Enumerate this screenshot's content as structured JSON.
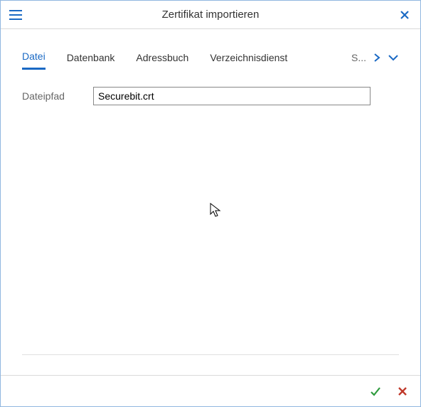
{
  "header": {
    "title": "Zertifikat importieren"
  },
  "tabs": {
    "items": [
      {
        "label": "Datei",
        "active": true
      },
      {
        "label": "Datenbank",
        "active": false
      },
      {
        "label": "Adressbuch",
        "active": false
      },
      {
        "label": "Verzeichnisdienst",
        "active": false
      }
    ],
    "overflow_indicator": "S..."
  },
  "form": {
    "filepath_label": "Dateipfad",
    "filepath_value": "Securebit.crt"
  },
  "icons": {
    "menu": "menu-icon",
    "close": "close-icon",
    "chevron_right": "chevron-right-icon",
    "chevron_down": "chevron-down-icon",
    "confirm": "check-icon",
    "cancel": "x-icon"
  },
  "colors": {
    "accent": "#1a69c4",
    "confirm": "#2e9b3e",
    "cancel": "#c0392b",
    "border": "#91b7e0"
  }
}
